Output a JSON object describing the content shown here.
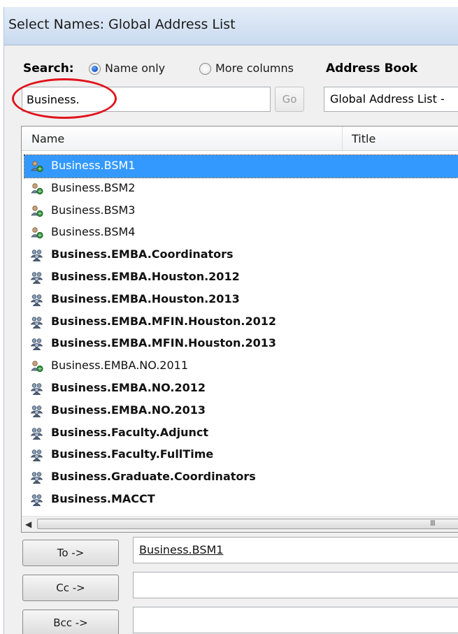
{
  "window": {
    "title": "Select Names: Global Address List"
  },
  "search": {
    "label": "Search:",
    "option_name_only": "Name only",
    "option_more_columns": "More columns",
    "selected_option": "Name only",
    "value": "Business.",
    "go_label": "Go"
  },
  "address_book": {
    "label": "Address Book",
    "selected": "Global Address List -"
  },
  "list": {
    "columns": [
      "Name",
      "Title"
    ],
    "rows": [
      {
        "name": "Business.BSM1",
        "type": "contact",
        "selected": true
      },
      {
        "name": "Business.BSM2",
        "type": "contact"
      },
      {
        "name": "Business.BSM3",
        "type": "contact"
      },
      {
        "name": "Business.BSM4",
        "type": "contact"
      },
      {
        "name": "Business.EMBA.Coordinators",
        "type": "group"
      },
      {
        "name": "Business.EMBA.Houston.2012",
        "type": "group"
      },
      {
        "name": "Business.EMBA.Houston.2013",
        "type": "group"
      },
      {
        "name": "Business.EMBA.MFIN.Houston.2012",
        "type": "group"
      },
      {
        "name": "Business.EMBA.MFIN.Houston.2013",
        "type": "group"
      },
      {
        "name": "Business.EMBA.NO.2011",
        "type": "contact"
      },
      {
        "name": "Business.EMBA.NO.2012",
        "type": "group"
      },
      {
        "name": "Business.EMBA.NO.2013",
        "type": "group"
      },
      {
        "name": "Business.Faculty.Adjunct",
        "type": "group"
      },
      {
        "name": "Business.Faculty.FullTime",
        "type": "group"
      },
      {
        "name": "Business.Graduate.Coordinators",
        "type": "group"
      },
      {
        "name": "Business.MACCT",
        "type": "group"
      }
    ],
    "scrollbar_grip": "III"
  },
  "recipients": {
    "to_label": "To ->",
    "to_value": "Business.BSM1",
    "cc_label": "Cc ->",
    "cc_value": "",
    "bcc_label": "Bcc ->",
    "bcc_value": ""
  },
  "colors": {
    "selection": "#3399ff",
    "highlight_circle": "#e0141c",
    "titlebar": "#c9daef"
  },
  "icons": {
    "contact": "user-icon",
    "group": "group-icon",
    "radio": "radio-icon"
  }
}
